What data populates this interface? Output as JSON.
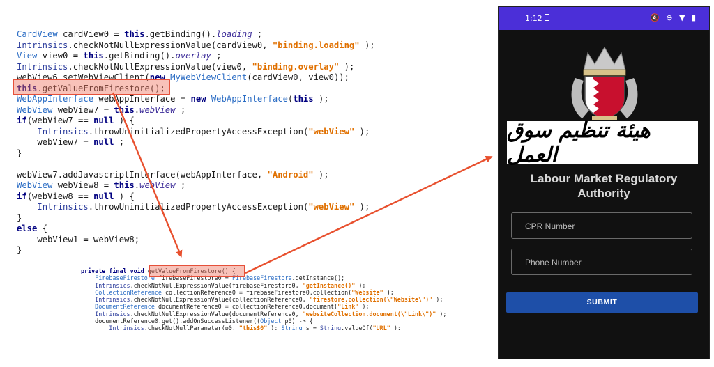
{
  "code_top": [
    [
      [
        "ty",
        "CardView"
      ],
      [
        "",
        "cardView0 = "
      ],
      [
        "kw",
        "this"
      ],
      [
        "",
        ".getBinding()."
      ],
      [
        "it",
        "loading"
      ],
      [
        "",
        ";"
      ]
    ],
    [
      [
        "cl",
        "Intrinsics"
      ],
      [
        "",
        ".checkNotNullExpressionValue(cardView0, "
      ],
      [
        "st",
        "\"binding.loading\""
      ],
      [
        "",
        ");"
      ]
    ],
    [
      [
        "ty",
        "View"
      ],
      [
        "",
        "view0 = "
      ],
      [
        "kw",
        "this"
      ],
      [
        "",
        ".getBinding()."
      ],
      [
        "it",
        "overlay"
      ],
      [
        "",
        ";"
      ]
    ],
    [
      [
        "cl",
        "Intrinsics"
      ],
      [
        "",
        ".checkNotNullExpressionValue(view0, "
      ],
      [
        "st",
        "\"binding.overlay\""
      ],
      [
        "",
        ");"
      ]
    ],
    [
      [
        "",
        "webView6.setWebViewClient("
      ],
      [
        "kw",
        "new"
      ],
      [
        "ty",
        "MyWebViewClient"
      ],
      [
        "",
        "(cardView0, view0));"
      ]
    ],
    [
      [
        "kw",
        "this"
      ],
      [
        "",
        ".getValueFromFirestore();"
      ]
    ],
    [
      [
        "ty",
        "WebAppInterface"
      ],
      [
        "",
        "webAppInterface = "
      ],
      [
        "kw",
        "new"
      ],
      [
        "ty",
        "WebAppInterface"
      ],
      [
        "",
        "("
      ],
      [
        "kw",
        "this"
      ],
      [
        "",
        "); "
      ]
    ],
    [
      [
        "ty",
        "WebView"
      ],
      [
        "",
        "webView7 = "
      ],
      [
        "kw",
        "this"
      ],
      [
        "",
        "."
      ],
      [
        "it",
        "webView"
      ],
      [
        "",
        ";"
      ]
    ],
    [
      [
        "kw",
        "if"
      ],
      [
        "",
        "(webView7 == "
      ],
      [
        "kw",
        "null"
      ],
      [
        "",
        ") {"
      ]
    ],
    [
      [
        "",
        "    "
      ],
      [
        "cl",
        "Intrinsics"
      ],
      [
        "",
        ".throwUninitializedPropertyAccessException("
      ],
      [
        "st",
        "\"webView\""
      ],
      [
        "",
        ");"
      ]
    ],
    [
      [
        "",
        "    webView7 = "
      ],
      [
        "kw",
        "null"
      ],
      [
        "",
        ";"
      ]
    ],
    [
      [
        "",
        "}"
      ]
    ],
    [
      [
        "",
        ""
      ]
    ],
    [
      [
        "",
        "webView7.addJavascriptInterface(webAppInterface, "
      ],
      [
        "st",
        "\"Android\""
      ],
      [
        "",
        ");"
      ]
    ],
    [
      [
        "ty",
        "WebView"
      ],
      [
        "",
        "webView8 = "
      ],
      [
        "kw",
        "this"
      ],
      [
        "",
        "."
      ],
      [
        "it",
        "webView"
      ],
      [
        "",
        ";"
      ]
    ],
    [
      [
        "kw",
        "if"
      ],
      [
        "",
        "(webView8 == "
      ],
      [
        "kw",
        "null"
      ],
      [
        "",
        ") {"
      ]
    ],
    [
      [
        "",
        "    "
      ],
      [
        "cl",
        "Intrinsics"
      ],
      [
        "",
        ".throwUninitializedPropertyAccessException("
      ],
      [
        "st",
        "\"webView\""
      ],
      [
        "",
        ");"
      ]
    ],
    [
      [
        "",
        "}"
      ]
    ],
    [
      [
        "kw",
        "else"
      ],
      [
        "",
        "{"
      ]
    ],
    [
      [
        "",
        "    webView1 = webView8;"
      ]
    ],
    [
      [
        "",
        "}"
      ]
    ]
  ],
  "code_bottom": [
    [
      [
        "kw",
        "private final void"
      ],
      [
        "",
        "getValueFromFirestore() {"
      ]
    ],
    [
      [
        "",
        "    "
      ],
      [
        "ty",
        "FirebaseFirestore"
      ],
      [
        "",
        "firebaseFirestore0 = "
      ],
      [
        "ty",
        "FirebaseFirestore"
      ],
      [
        "",
        ".getInstance();"
      ]
    ],
    [
      [
        "",
        "    "
      ],
      [
        "cl",
        "Intrinsics"
      ],
      [
        "",
        ".checkNotNullExpressionValue(firebaseFirestore0, "
      ],
      [
        "st",
        "\"getInstance()\""
      ],
      [
        "",
        ");"
      ]
    ],
    [
      [
        "",
        "    "
      ],
      [
        "ty",
        "CollectionReference"
      ],
      [
        "",
        "collectionReference0 = firebaseFirestore0.collection("
      ],
      [
        "st",
        "\"Website\""
      ],
      [
        "",
        ");"
      ]
    ],
    [
      [
        "",
        "    "
      ],
      [
        "cl",
        "Intrinsics"
      ],
      [
        "",
        ".checkNotNullExpressionValue(collectionReference0, "
      ],
      [
        "st",
        "\"firestore.collection(\\\"Website\\\")\""
      ],
      [
        "",
        ");"
      ]
    ],
    [
      [
        "",
        "    "
      ],
      [
        "ty",
        "DocumentReference"
      ],
      [
        "",
        "documentReference0 = collectionReference0.document("
      ],
      [
        "st",
        "\"Link\""
      ],
      [
        "",
        ");"
      ]
    ],
    [
      [
        "",
        "    "
      ],
      [
        "cl",
        "Intrinsics"
      ],
      [
        "",
        ".checkNotNullExpressionValue(documentReference0, "
      ],
      [
        "st",
        "\"websiteCollection.document(\\\"Link\\\")\""
      ],
      [
        "",
        ");"
      ]
    ],
    [
      [
        "",
        "    documentReference0.get().addOnSuccessListener(("
      ],
      [
        "ty",
        "Object"
      ],
      [
        "",
        "p0) -> {"
      ]
    ],
    [
      [
        "",
        "        "
      ],
      [
        "cl",
        "Intrinsics"
      ],
      [
        "",
        ".checkNotNullParameter(p0, "
      ],
      [
        "st",
        "\"this$0\""
      ],
      [
        "",
        "); "
      ],
      [
        "ty",
        "String"
      ],
      [
        "",
        "s = "
      ],
      [
        "cl",
        "String"
      ],
      [
        "",
        ".valueOf("
      ],
      [
        "st",
        "\"URL\""
      ],
      [
        "",
        ");"
      ]
    ]
  ],
  "status_bar": {
    "time": "1:12",
    "icons": "🔇 ⊖ ▼ ▮",
    "color": "#4b2fd8"
  },
  "phone": {
    "org_name_arabic": "هيئة تنظيم سوق العمل",
    "title_line1": "Labour Market Regulatory",
    "title_line2": "Authority",
    "cpr_placeholder": "CPR Number",
    "phone_placeholder": "Phone Number",
    "submit_label": "SUBMIT"
  },
  "colors": {
    "highlight": "#e5503a",
    "arrow": "#e8502e",
    "submit": "#1e4fa8"
  }
}
